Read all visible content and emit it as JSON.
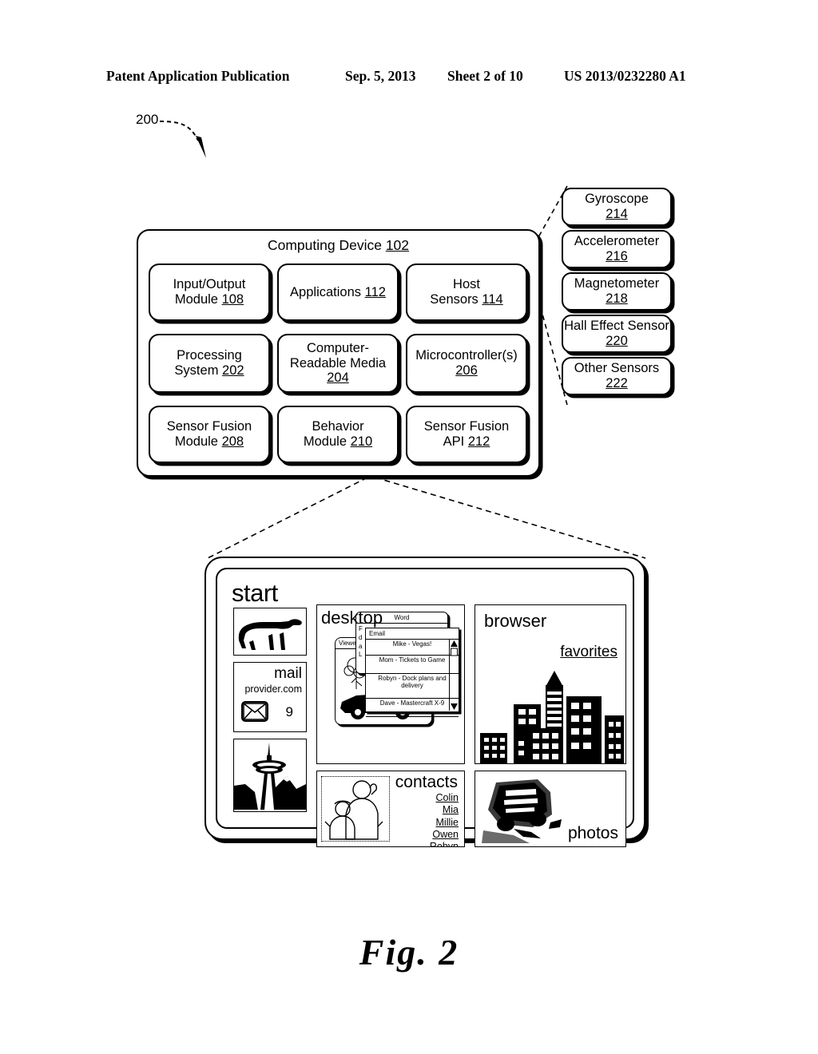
{
  "header": {
    "publication": "Patent Application Publication",
    "date": "Sep. 5, 2013",
    "sheet": "Sheet 2 of 10",
    "number": "US 2013/0232280 A1"
  },
  "figure": {
    "reference_numeral": "200",
    "caption": "Fig. 2"
  },
  "computing_device": {
    "title": "Computing Device",
    "title_ref": "102",
    "modules": [
      {
        "line1": "Input/Output",
        "line2": "Module",
        "ref": "108"
      },
      {
        "line1": "Applications",
        "line2": "",
        "ref": "112"
      },
      {
        "line1": "Host",
        "line2": "Sensors",
        "ref": "114"
      },
      {
        "line1": "Processing",
        "line2": "System",
        "ref": "202"
      },
      {
        "line1": "Computer-",
        "line2": "Readable Media",
        "ref": "204"
      },
      {
        "line1": "Microcontroller(s)",
        "line2": "",
        "ref": "206"
      },
      {
        "line1": "Sensor Fusion",
        "line2": "Module",
        "ref": "208"
      },
      {
        "line1": "Behavior",
        "line2": "Module",
        "ref": "210"
      },
      {
        "line1": "Sensor Fusion",
        "line2": "API",
        "ref": "212"
      }
    ]
  },
  "sensors": [
    {
      "label": "Gyroscope",
      "ref": "214"
    },
    {
      "label": "Accelerometer",
      "ref": "216"
    },
    {
      "label": "Magnetometer",
      "ref": "218"
    },
    {
      "label": "Hall Effect Sensor",
      "ref": "220"
    },
    {
      "label": "Other Sensors",
      "ref": "222"
    }
  ],
  "tablet": {
    "tiles": {
      "start_label": "start",
      "desktop_label": "desktop",
      "browser_label": "browser",
      "favorites_label": "favorites",
      "contacts_label": "contacts",
      "photos_label": "photos"
    },
    "mail": {
      "title": "mail",
      "provider": "provider.com",
      "unread_count": "9"
    },
    "windows": [
      {
        "title": "Word"
      },
      {
        "title": "Email"
      },
      {
        "title": "Viewer"
      }
    ],
    "email_messages": [
      "Mike - Vegas!",
      "Mom - Tickets to Game",
      "Robyn - Dock plans and delivery",
      "Dave - Mastercraft X-9"
    ],
    "contacts": [
      "Colin",
      "Mia",
      "Millie",
      "Owen",
      "Robyn"
    ]
  },
  "colors": {
    "ink": "#000000",
    "paper": "#ffffff"
  }
}
